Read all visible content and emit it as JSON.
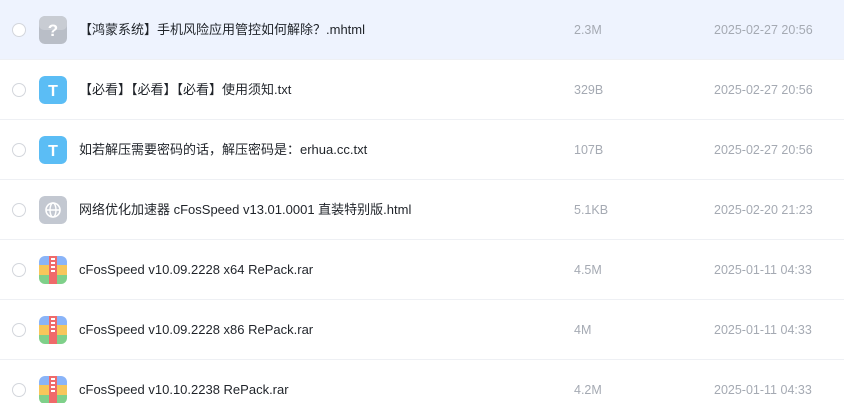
{
  "files": [
    {
      "icon": "unknown-file-icon",
      "name": "【鸿蒙系统】手机风险应用管控如何解除？.mhtml",
      "size": "2.3M",
      "date": "2025-02-27 20:56",
      "selected": true
    },
    {
      "icon": "text-file-icon",
      "name": "【必看】【必看】【必看】使用须知.txt",
      "size": "329B",
      "date": "2025-02-27 20:56"
    },
    {
      "icon": "text-file-icon",
      "name": "如若解压需要密码的话，解压密码是：erhua.cc.txt",
      "size": "107B",
      "date": "2025-02-27 20:56"
    },
    {
      "icon": "web-file-icon",
      "name": "网络优化加速器 cFosSpeed v13.01.0001 直装特别版.html",
      "size": "5.1KB",
      "date": "2025-02-20 21:23"
    },
    {
      "icon": "archive-file-icon",
      "name": "cFosSpeed v10.09.2228 x64 RePack.rar",
      "size": "4.5M",
      "date": "2025-01-11 04:33"
    },
    {
      "icon": "archive-file-icon",
      "name": "cFosSpeed v10.09.2228 x86 RePack.rar",
      "size": "4M",
      "date": "2025-01-11 04:33"
    },
    {
      "icon": "archive-file-icon",
      "name": "cFosSpeed v10.10.2238 RePack.rar",
      "size": "4.2M",
      "date": "2025-01-11 04:33"
    }
  ],
  "colors": {
    "selected_row_bg": "#eef3fe",
    "text_icon_bg": "#5bbdf5",
    "unknown_icon_bg": "#b9bec7",
    "web_icon_bg": "#c3c8d1",
    "meta_text": "#a5aab3"
  }
}
